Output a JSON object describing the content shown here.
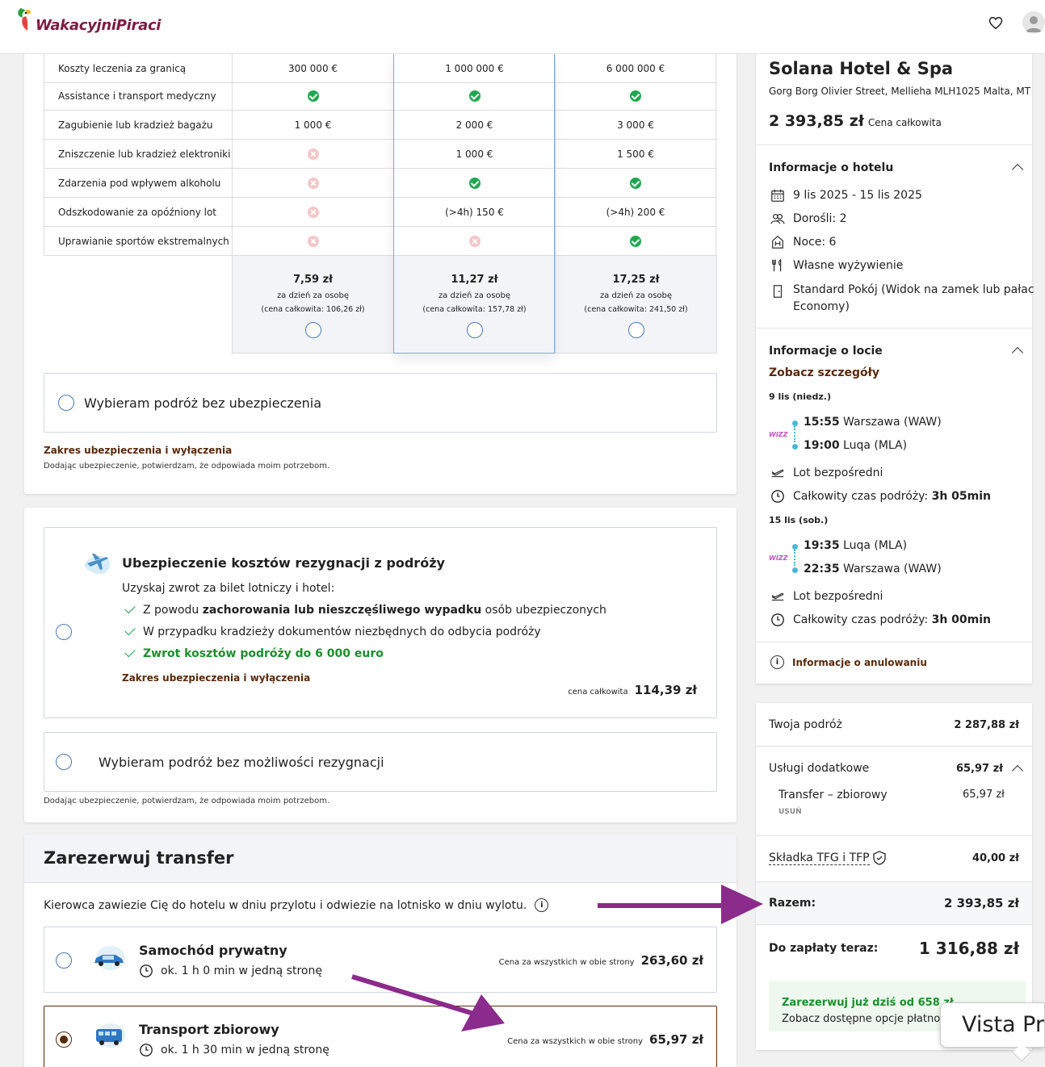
{
  "header": {
    "logo": "WakacyjniPiraci"
  },
  "insurance_table": {
    "rows": [
      {
        "label": "Koszty leczenia za granicą",
        "cells": [
          "300 000 €",
          "1 000 000 €",
          "6 000 000 €"
        ]
      },
      {
        "label": "Assistance i transport medyczny",
        "cells": [
          "check",
          "check",
          "check"
        ]
      },
      {
        "label": "Zagubienie lub kradzież bagażu",
        "cells": [
          "1 000 €",
          "2 000 €",
          "3 000 €"
        ]
      },
      {
        "label": "Zniszczenie lub kradzież elektroniki",
        "cells": [
          "cross",
          "1 000 €",
          "1 500 €"
        ]
      },
      {
        "label": "Zdarzenia pod wpływem alkoholu",
        "cells": [
          "cross",
          "check",
          "check"
        ]
      },
      {
        "label": "Odszkodowanie za opóźniony lot",
        "cells": [
          "cross",
          "(>4h) 150 €",
          "(>4h) 200 €"
        ]
      },
      {
        "label": "Uprawianie sportów ekstremalnych",
        "cells": [
          "cross",
          "cross",
          "check"
        ]
      }
    ],
    "prices": [
      {
        "price": "7,59 zł",
        "per": "za dzień za osobę",
        "total": "(cena całkowita: 106,26 zł)"
      },
      {
        "price": "11,27 zł",
        "per": "za dzień za osobę",
        "total": "(cena całkowita: 157,78 zł)"
      },
      {
        "price": "17,25 zł",
        "per": "za dzień za osobę",
        "total": "(cena całkowita: 241,50 zł)"
      }
    ],
    "no_insurance": "Wybieram podróż bez ubezpieczenia",
    "scope_link": "Zakres ubezpieczenia i wyłączenia",
    "consent": "Dodając ubezpieczenie, potwierdzam, że odpowiada moim potrzebom."
  },
  "cancellation": {
    "title": "Ubezpieczenie kosztów rezygnacji z podróży",
    "intro": "Uzyskaj zwrot za bilet lotniczy i hotel:",
    "b1_pre": "Z powodu ",
    "b1_bold": "zachorowania lub nieszczęśliwego wypadku",
    "b1_post": " osób ubezpieczonych",
    "b2": "W przypadku kradzieży dokumentów niezbędnych do odbycia podróży",
    "b3": "Zwrot kosztów podróży do 6 000 euro",
    "scope_link": "Zakres ubezpieczenia i wyłączenia",
    "price_label": "cena całkowita",
    "price": "114,39 zł",
    "no_option": "Wybieram podróż bez możliwości rezygnacji",
    "consent": "Dodając ubezpieczenie, potwierdzam, że odpowiada moim potrzebom."
  },
  "transfer": {
    "title": "Zarezerwuj transfer",
    "desc": "Kierowca zawiezie Cię do hotelu w dniu przylotu i odwiezie na lotnisko w dniu wylotu.",
    "options": [
      {
        "name": "Samochód prywatny",
        "time": "ok. 1 h 0 min w jedną stronę",
        "price_label": "Cena za wszystkich w obie strony",
        "price": "263,60 zł"
      },
      {
        "name": "Transport zbiorowy",
        "time": "ok. 1 h 30 min w jedną stronę",
        "price_label": "Cena za wszystkich w obie strony",
        "price": "65,97 zł"
      }
    ]
  },
  "hotel": {
    "name": "Solana Hotel & Spa",
    "address": "Gorg Borg Olivier Street, Mellieha MLH1025 Malta, MT",
    "price": "2 393,85 zł",
    "price_label": "Cena całkowita",
    "info_title": "Informacje o hotelu",
    "dates": "9 lis 2025 - 15 lis 2025",
    "adults": "Dorośli: 2",
    "nights": "Noce: 6",
    "board": "Własne wyżywienie",
    "room_line1": "Standard Pokój (Widok na zamek lub pałac",
    "room_line2": "Economy)"
  },
  "flight": {
    "title": "Informacje o locie",
    "details_link": "Zobacz szczegóły",
    "outbound": {
      "date": "9 lis (niedz.)",
      "dep_time": "15:55",
      "dep_place": "Warszawa (WAW)",
      "arr_time": "19:00",
      "arr_place": "Luqa (MLA)",
      "direct": "Lot bezpośredni",
      "dur_label": "Całkowity czas podróży:",
      "dur": "3h 05min"
    },
    "inbound": {
      "date": "15 lis (sob.)",
      "dep_time": "19:35",
      "dep_place": "Luqa (MLA)",
      "arr_time": "22:35",
      "arr_place": "Warszawa (WAW)",
      "direct": "Lot bezpośredni",
      "dur_label": "Całkowity czas podróży:",
      "dur": "3h 00min"
    },
    "airline": "WIZZ",
    "cancel_info": "Informacje o anulowaniu"
  },
  "summary": {
    "trip_label": "Twoja podróż",
    "trip": "2 287,88 zł",
    "extras_label": "Usługi dodatkowe",
    "extras": "65,97 zł",
    "extra_item": "Transfer – zbiorowy",
    "extra_item_price": "65,97 zł",
    "remove": "USUŃ",
    "tfg_label": "Składka TFG i TFP",
    "tfg": "40,00 zł",
    "total_label": "Razem:",
    "total": "2 393,85 zł",
    "now_label": "Do zapłaty teraz:",
    "now": "1 316,88 zł",
    "promo_title": "Zarezerwuj już dziś od 658 zł",
    "promo_sub": "Zobacz dostępne opcje płatno",
    "tooltip": "Vista Pre"
  },
  "colors": {
    "brand": "#7a1d40",
    "check": "#1ea84f",
    "arrow": "#8b2b8b",
    "link": "#5a2a0c"
  }
}
